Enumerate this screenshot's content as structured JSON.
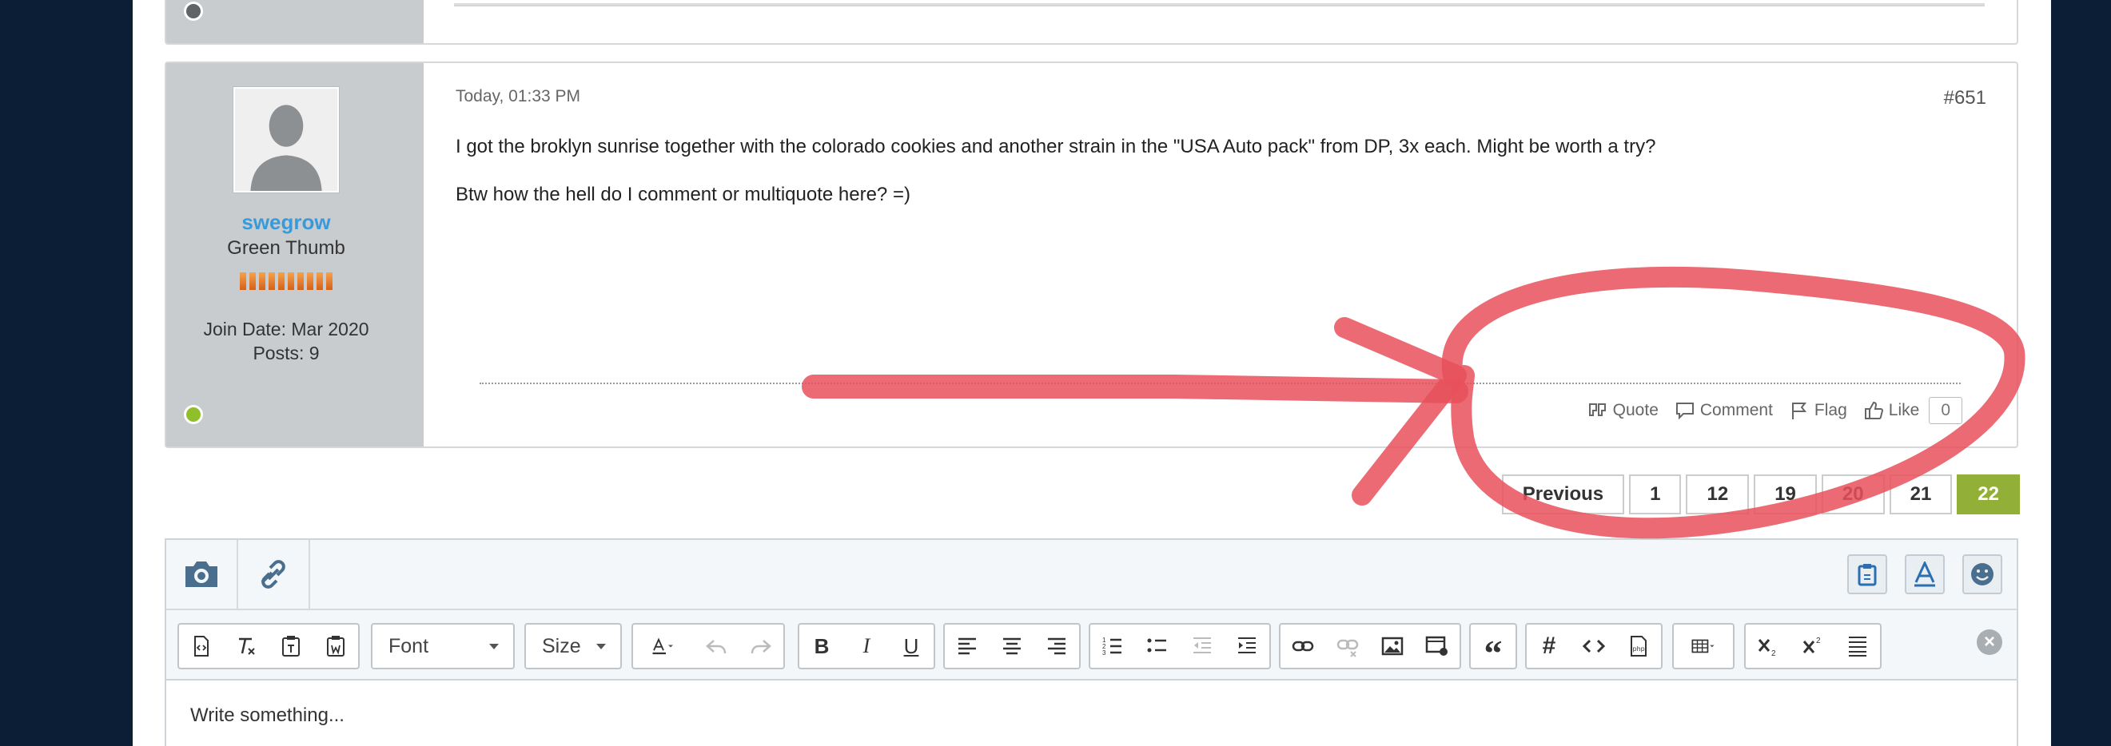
{
  "post": {
    "date": "Today, 01:33 PM",
    "number": "#651",
    "body": [
      "I got the broklyn sunrise together with the colorado cookies and another strain in the \"USA Auto pack\" from DP, 3x each. Might be worth a try?",
      "Btw how the hell do I comment or multiquote here? =)"
    ],
    "author": {
      "username": "swegrow",
      "title": "Green Thumb",
      "join_date": "Join Date: Mar 2020",
      "posts": "Posts: 9"
    },
    "actions": {
      "quote": "Quote",
      "comment": "Comment",
      "flag": "Flag",
      "like": "Like",
      "like_count": "0"
    }
  },
  "pagination": {
    "previous": "Previous",
    "pages": [
      "1",
      "12",
      "19",
      "20",
      "21",
      "22"
    ],
    "current": "22"
  },
  "editor": {
    "font_label": "Font",
    "size_label": "Size",
    "placeholder": "Write something..."
  },
  "colors": {
    "accent": "#3a9ad9",
    "current_page": "#92b038",
    "annotation": "#e8505b",
    "background": "#0c1e36"
  }
}
